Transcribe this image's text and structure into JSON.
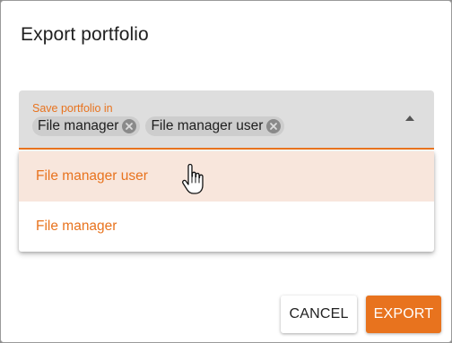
{
  "dialog": {
    "title": "Export portfolio"
  },
  "select": {
    "label": "Save portfolio in",
    "chips": [
      {
        "label": "File manager",
        "remove_icon": "cancel-circle-icon"
      },
      {
        "label": "File manager user",
        "remove_icon": "cancel-circle-icon"
      }
    ],
    "arrow_icon": "arrow-drop-up-icon"
  },
  "menu": {
    "items": [
      {
        "label": "File manager user",
        "hovered": true
      },
      {
        "label": "File manager",
        "hovered": false
      }
    ]
  },
  "buttons": {
    "cancel_label": "CANCEL",
    "export_label": "EXPORT"
  },
  "cursor": {
    "icon": "hand-pointer-icon"
  },
  "colors": {
    "accent": "#e8731e",
    "field_bg": "#dedede",
    "hover_bg": "#f8e6dc"
  }
}
